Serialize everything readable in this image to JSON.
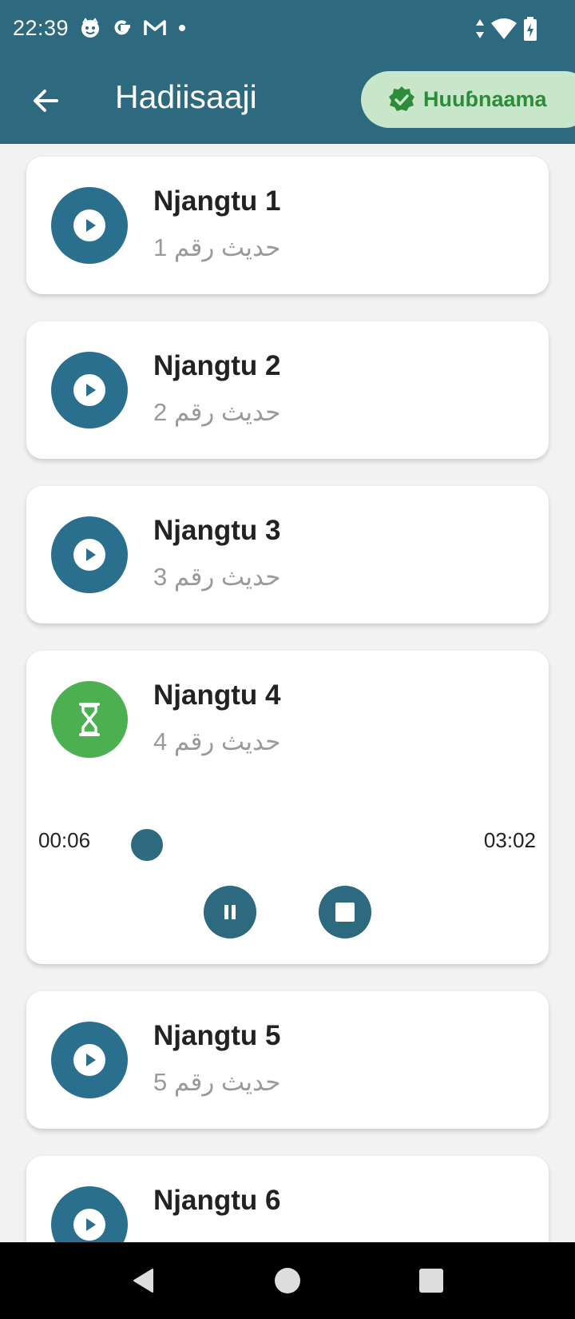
{
  "status_bar": {
    "time": "22:39",
    "icons_left": [
      "face-icon",
      "google-icon",
      "gmail-icon",
      "dot-icon"
    ],
    "icons_right": [
      "data-arrows-icon",
      "wifi-icon",
      "battery-charging-icon"
    ]
  },
  "app_bar": {
    "back_icon": "arrow-left-icon",
    "title": "Hadiisaaji",
    "verified_chip": {
      "icon": "verified-badge-icon",
      "label": "Huuɓnaama"
    }
  },
  "colors": {
    "primary": "#2d6a7f",
    "play_circle": "#2a6f8d",
    "loading_circle": "#4caf50",
    "chip_bg": "#c8e6c9",
    "chip_text": "#2e8b3a",
    "subtitle": "#9a9a9a"
  },
  "items": [
    {
      "title": "Njangtu 1",
      "subtitle": "حديث رقم 1",
      "state": "play"
    },
    {
      "title": "Njangtu 2",
      "subtitle": "حديث رقم 2",
      "state": "play"
    },
    {
      "title": "Njangtu 3",
      "subtitle": "حديث رقم 3",
      "state": "play"
    },
    {
      "title": "Njangtu 4",
      "subtitle": "حديث رقم 4",
      "state": "loading"
    },
    {
      "title": "Njangtu 5",
      "subtitle": "حديث رقم 5",
      "state": "play"
    },
    {
      "title": "Njangtu 6",
      "subtitle": "",
      "state": "play"
    }
  ],
  "player": {
    "elapsed": "00:06",
    "duration": "03:02",
    "progress_fraction": 0.033,
    "controls": [
      "pause-icon",
      "stop-icon"
    ]
  },
  "nav_bar": {
    "buttons": [
      "back-triangle-icon",
      "home-circle-icon",
      "recents-square-icon"
    ]
  }
}
